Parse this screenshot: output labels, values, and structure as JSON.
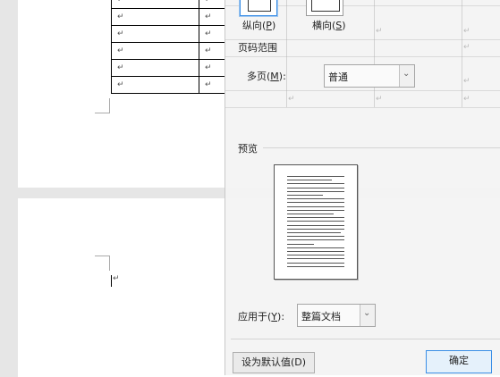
{
  "document": {
    "table_rows": [
      [
        "↵",
        "↵"
      ],
      [
        "↵",
        "↵"
      ],
      [
        "↵",
        "↵"
      ],
      [
        "↵",
        "↵"
      ],
      [
        "↵",
        "↵"
      ],
      [
        "↵",
        "↵"
      ]
    ],
    "paragraph_mark": "↵",
    "faint_mark": "↵"
  },
  "dialog": {
    "orientation": {
      "portrait_label": "纵向(P)",
      "portrait_key": "P",
      "landscape_label": "横向(S)",
      "landscape_key": "S",
      "selected": "portrait"
    },
    "page_range": {
      "group_label": "页码范围",
      "multi_page_label": "多页(M):",
      "multi_page_value": "普通"
    },
    "preview": {
      "group_label": "预览"
    },
    "apply_to": {
      "label": "应用于(Y):",
      "value": "整篇文档"
    },
    "buttons": {
      "set_default": "设为默认值(D)",
      "ok": "确定"
    }
  },
  "colors": {
    "accent": "#3a8ee6"
  }
}
